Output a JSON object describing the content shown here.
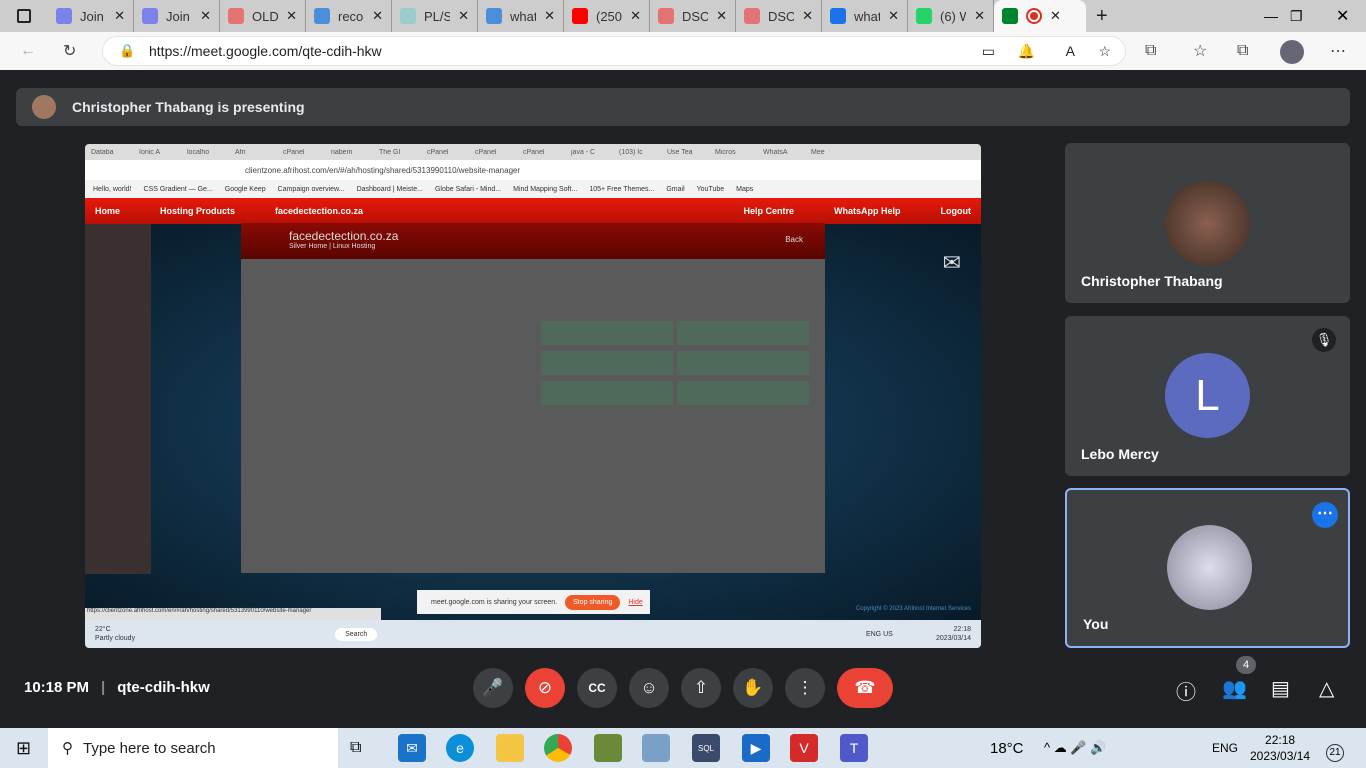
{
  "browser": {
    "tabs": [
      {
        "title": "Join c",
        "icon": "teams-icon",
        "color": "#7b83eb"
      },
      {
        "title": "Join c",
        "icon": "teams-icon",
        "color": "#7b83eb"
      },
      {
        "title": "OLD",
        "icon": "pdf-icon",
        "color": "#e57373"
      },
      {
        "title": "recor",
        "icon": "search-icon",
        "color": "#4a90d9"
      },
      {
        "title": "PL/SC",
        "icon": "p-icon",
        "color": "#9cc"
      },
      {
        "title": "what",
        "icon": "search-icon",
        "color": "#4a90d9"
      },
      {
        "title": "(250)",
        "icon": "youtube-icon",
        "color": "#ff0000"
      },
      {
        "title": "DSO2",
        "icon": "pdf-icon",
        "color": "#e57373"
      },
      {
        "title": "DSO2",
        "icon": "pdf-icon",
        "color": "#e57373"
      },
      {
        "title": "what",
        "icon": "search-icon",
        "color": "#1a73e8"
      },
      {
        "title": "(6) W",
        "icon": "whatsapp-icon",
        "color": "#25d366"
      }
    ],
    "url": "https://meet.google.com/qte-cdih-hkw"
  },
  "meet": {
    "presenting": "Christopher Thabang is presenting",
    "participants": [
      {
        "name": "Christopher Thabang"
      },
      {
        "name": "Lebo Mercy",
        "initial": "L",
        "color": "#5c6bc0"
      },
      {
        "name": "You"
      }
    ],
    "time": "10:18 PM",
    "meeting_code": "qte-cdih-hkw",
    "people_count": "4"
  },
  "shared_screen": {
    "tabs": [
      "Databa",
      "Ionic A",
      "localho",
      "Afri",
      "cPanel",
      "nabem",
      "The GI",
      "cPanel",
      "cPanel",
      "cPanel",
      "java - C",
      "(103) Ic",
      "Use Tea",
      "Micros",
      "WhatsA",
      "Mee"
    ],
    "url": "clientzone.afrihost.com/en/#/ah/hosting/shared/5313990110/website-manager",
    "bookmarks": [
      "Hello, world!",
      "CSS Gradient — Ge...",
      "Google Keep",
      "Campaign overview...",
      "Dashboard | Meiste...",
      "Globe Safari - Mind...",
      "Mind Mapping Soft...",
      "105+ Free Themes...",
      "Gmail",
      "YouTube",
      "Maps"
    ],
    "nav": [
      "Home",
      "Hosting Products",
      "facedectection.co.za"
    ],
    "nav_right": [
      "Help Centre",
      "WhatsApp Help",
      "Logout"
    ],
    "modal_title": "facedectection.co.za",
    "modal_subtitle": "Silver Home | Linux Hosting",
    "back": "Back",
    "status_url": "https://clientzone.afrihost.com/en/#/ah/hosting/shared/5313990110/website-manager",
    "share_msg": "meet.google.com is sharing your screen.",
    "stop_sharing": "Stop sharing",
    "hide": "Hide",
    "copyright": "Copyright © 2023 Afrihost Internet Services",
    "weather_temp": "22°C",
    "weather_desc": "Partly cloudy",
    "search": "Search",
    "lang": "ENG US",
    "time": "22:18",
    "date": "2023/03/14"
  },
  "taskbar": {
    "search_placeholder": "Type here to search",
    "temp": "18°C",
    "lang": "ENG",
    "time": "22:18",
    "date": "2023/03/14",
    "notifications": "21"
  }
}
